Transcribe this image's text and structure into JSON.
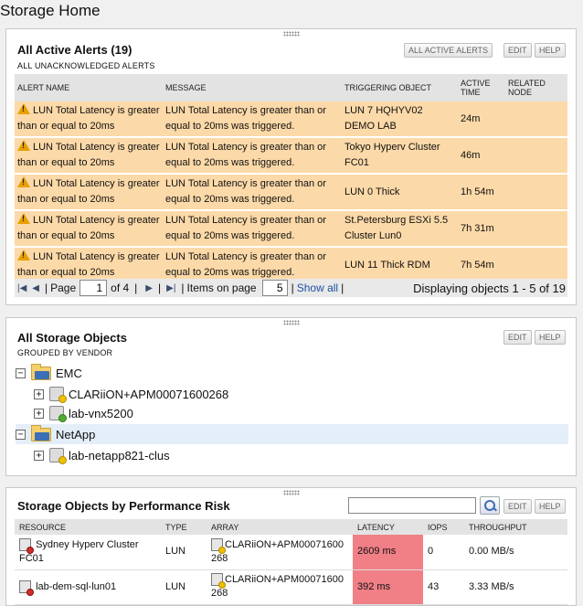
{
  "page_title": "Storage Home",
  "alerts": {
    "title": "All Active Alerts (19)",
    "subtitle": "ALL UNACKNOWLEDGED ALERTS",
    "buttons": {
      "all": "ALL ACTIVE ALERTS",
      "edit": "EDIT",
      "help": "HELP"
    },
    "columns": [
      "ALERT NAME",
      "MESSAGE",
      "TRIGGERING OBJECT",
      "ACTIVE TIME",
      "RELATED NODE"
    ],
    "rows": [
      {
        "name": "LUN Total Latency is greater than or equal to 20ms",
        "message": "LUN Total Latency is greater than or equal to 20ms was triggered.",
        "object": "LUN 7 HQHYV02 DEMO LAB",
        "time": "24m",
        "node": ""
      },
      {
        "name": "LUN Total Latency is greater than or equal to 20ms",
        "message": "LUN Total Latency is greater than or equal to 20ms was triggered.",
        "object": "Tokyo Hyperv Cluster FC01",
        "time": "46m",
        "node": ""
      },
      {
        "name": "LUN Total Latency is greater than or equal to 20ms",
        "message": "LUN Total Latency is greater than or equal to 20ms was triggered.",
        "object": "LUN 0 Thick",
        "time": "1h 54m",
        "node": ""
      },
      {
        "name": "LUN Total Latency is greater than or equal to 20ms",
        "message": "LUN Total Latency is greater than or equal to 20ms was triggered.",
        "object": "St.Petersburg ESXi 5.5 Cluster Lun0",
        "time": "7h 31m",
        "node": ""
      },
      {
        "name": "LUN Total Latency is greater than or equal to 20ms",
        "message": "LUN Total Latency is greater than or equal to 20ms was triggered.",
        "object": "LUN 11 Thick RDM",
        "time": "7h 54m",
        "node": ""
      }
    ],
    "pager": {
      "page_label": "Page",
      "page_value": "1",
      "of_label": "of 4",
      "items_label": "Items on page",
      "items_value": "5",
      "show_all": "Show all",
      "displaying": "Displaying objects 1 - 5 of 19"
    }
  },
  "storage_objects": {
    "title": "All Storage Objects",
    "subtitle": "GROUPED BY VENDOR",
    "buttons": {
      "edit": "EDIT",
      "help": "HELP"
    },
    "vendors": [
      {
        "name": "EMC",
        "children": [
          {
            "name": "CLARiiON+APM00071600268",
            "status": "warning"
          },
          {
            "name": "lab-vnx5200",
            "status": "up"
          }
        ]
      },
      {
        "name": "NetApp",
        "children": [
          {
            "name": "lab-netapp821-clus",
            "status": "warning"
          }
        ]
      }
    ]
  },
  "risk": {
    "title": "Storage Objects by Performance Risk",
    "search_placeholder": "",
    "buttons": {
      "edit": "EDIT",
      "help": "HELP"
    },
    "columns": [
      "RESOURCE",
      "TYPE",
      "ARRAY",
      "LATENCY",
      "IOPS",
      "THROUGHPUT"
    ],
    "rows": [
      {
        "resource": "Sydney Hyperv Cluster FC01",
        "type": "LUN",
        "array": "CLARiiON+APM00071600268",
        "latency": "2609 ms",
        "iops": "0",
        "throughput": "0.00 MB/s"
      },
      {
        "resource": "lab-dem-sql-lun01",
        "type": "LUN",
        "array": "CLARiiON+APM00071600268",
        "latency": "392 ms",
        "iops": "43",
        "throughput": "3.33 MB/s"
      }
    ]
  },
  "colors": {
    "alert_row": "#fcd9a8",
    "latency_bad": "#f07f86",
    "link": "#1f4fa3"
  }
}
